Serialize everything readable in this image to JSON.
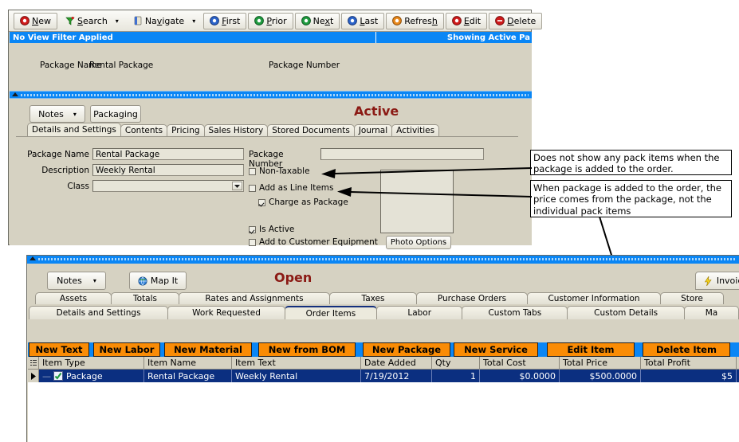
{
  "upper_window": {
    "toolbar": [
      {
        "name": "new",
        "label": "New",
        "accel": "N",
        "icon": "record-red-icon",
        "dropdown": false
      },
      {
        "name": "search",
        "label": "Search",
        "accel": "S",
        "icon": "funnel-green-icon",
        "dropdown": true
      },
      {
        "name": "navigate",
        "label": "Navigate",
        "accel": "g",
        "icon": "book-blue-icon",
        "dropdown": true
      },
      {
        "name": "first",
        "label": "First",
        "accel": "F",
        "icon": "record-blue-icon",
        "dropdown": false
      },
      {
        "name": "prior",
        "label": "Prior",
        "accel": "P",
        "icon": "record-green-icon",
        "dropdown": false
      },
      {
        "name": "next",
        "label": "Next",
        "accel": "x",
        "icon": "record-green-icon",
        "dropdown": false
      },
      {
        "name": "last",
        "label": "Last",
        "accel": "L",
        "icon": "record-blue-icon",
        "dropdown": false
      },
      {
        "name": "refresh",
        "label": "Refresh",
        "accel": "h",
        "icon": "record-orange-icon",
        "dropdown": false
      },
      {
        "name": "edit",
        "label": "Edit",
        "accel": "E",
        "icon": "record-red-icon",
        "dropdown": false
      },
      {
        "name": "delete",
        "label": "Delete",
        "accel": "D",
        "icon": "record-red-icon",
        "dropdown": false
      }
    ],
    "status_bar": {
      "left": "No View Filter Applied",
      "right": "Showing Active Pa"
    },
    "header_panel": {
      "package_name_label": "Package Name",
      "package_name_value": "Rental Package",
      "package_number_label": "Package Number",
      "package_number_value": ""
    },
    "notes_button": "Notes",
    "packaging_button": "Packaging",
    "status_word": "Active",
    "tabs": [
      {
        "label": "Details and Settings",
        "selected": true
      },
      {
        "label": "Contents",
        "selected": false
      },
      {
        "label": "Pricing",
        "selected": false
      },
      {
        "label": "Sales History",
        "selected": false
      },
      {
        "label": "Stored Documents",
        "selected": false
      },
      {
        "label": "Journal",
        "selected": false
      },
      {
        "label": "Activities",
        "selected": false
      }
    ],
    "form": {
      "package_name_label": "Package Name",
      "package_name_value": "Rental Package",
      "description_label": "Description",
      "description_value": "Weekly Rental",
      "class_label": "Class",
      "class_value": "",
      "package_number_label": "Package Number",
      "package_number_value": "",
      "checkboxes": [
        {
          "name": "non-taxable",
          "label": "Non-Taxable",
          "checked": false
        },
        {
          "name": "add-as-line-items",
          "label": "Add as Line Items",
          "checked": false
        },
        {
          "name": "charge-as-package",
          "label": "Charge as Package",
          "checked": true
        },
        {
          "name": "is-active",
          "label": "Is Active",
          "checked": true
        },
        {
          "name": "add-to-customer-equipment",
          "label": "Add to Customer Equipment",
          "checked": false
        }
      ],
      "photo_options_button": "Photo Options"
    }
  },
  "annotations": [
    {
      "name": "annotation-line-items",
      "text": "Does not show any pack items when the package is added to the order."
    },
    {
      "name": "annotation-package-price",
      "text": "When package is added to the order, the price comes from the package, not the individual pack items"
    }
  ],
  "lower_window": {
    "notes_button": "Notes",
    "map_it_button": "Map It",
    "status_word": "Open",
    "invoice_button": "Invoice",
    "tabs_row1": [
      {
        "label": "Assets",
        "selected": false
      },
      {
        "label": "Totals",
        "selected": false
      },
      {
        "label": "Rates and Assignments",
        "selected": false
      },
      {
        "label": "Taxes",
        "selected": false
      },
      {
        "label": "Purchase Orders",
        "selected": false
      },
      {
        "label": "Customer Information",
        "selected": false
      },
      {
        "label": "Store",
        "selected": false
      }
    ],
    "tabs_row2": [
      {
        "label": "Details and Settings",
        "selected": false
      },
      {
        "label": "Work Requested",
        "selected": false
      },
      {
        "label": "Order Items",
        "selected": true
      },
      {
        "label": "Labor",
        "selected": false
      },
      {
        "label": "Custom Tabs",
        "selected": false
      },
      {
        "label": "Custom Details",
        "selected": false
      },
      {
        "label": "Ma",
        "selected": false
      }
    ],
    "action_buttons": [
      {
        "name": "new-text",
        "label": "New Text"
      },
      {
        "name": "new-labor",
        "label": "New Labor"
      },
      {
        "name": "new-material",
        "label": "New Material"
      },
      {
        "name": "new-from-bom",
        "label": "New from BOM"
      },
      {
        "name": "new-package",
        "label": "New Package"
      },
      {
        "name": "new-service",
        "label": "New Service"
      },
      {
        "name": "edit-item",
        "label": "Edit Item"
      },
      {
        "name": "delete-item",
        "label": "Delete Item"
      }
    ],
    "grid": {
      "columns": [
        "Item Type",
        "Item Name",
        "Item Text",
        "Date Added",
        "Qty",
        "Total Cost",
        "Total Price",
        "Total Profit"
      ],
      "rows": [
        {
          "item_type": "Package",
          "item_name": "Rental Package",
          "item_text": "Weekly Rental",
          "date_added": "7/19/2012",
          "qty": "1",
          "total_cost": "$0.0000",
          "total_price": "$500.0000",
          "total_profit": "$5",
          "selected": true
        }
      ]
    }
  },
  "colors": {
    "accent_blue": "#0a86f5",
    "orange_button": "#fa8c05",
    "row_select": "#0b2f80",
    "status_red": "#8b1a14",
    "panel_bg": "#d6d2c2"
  }
}
